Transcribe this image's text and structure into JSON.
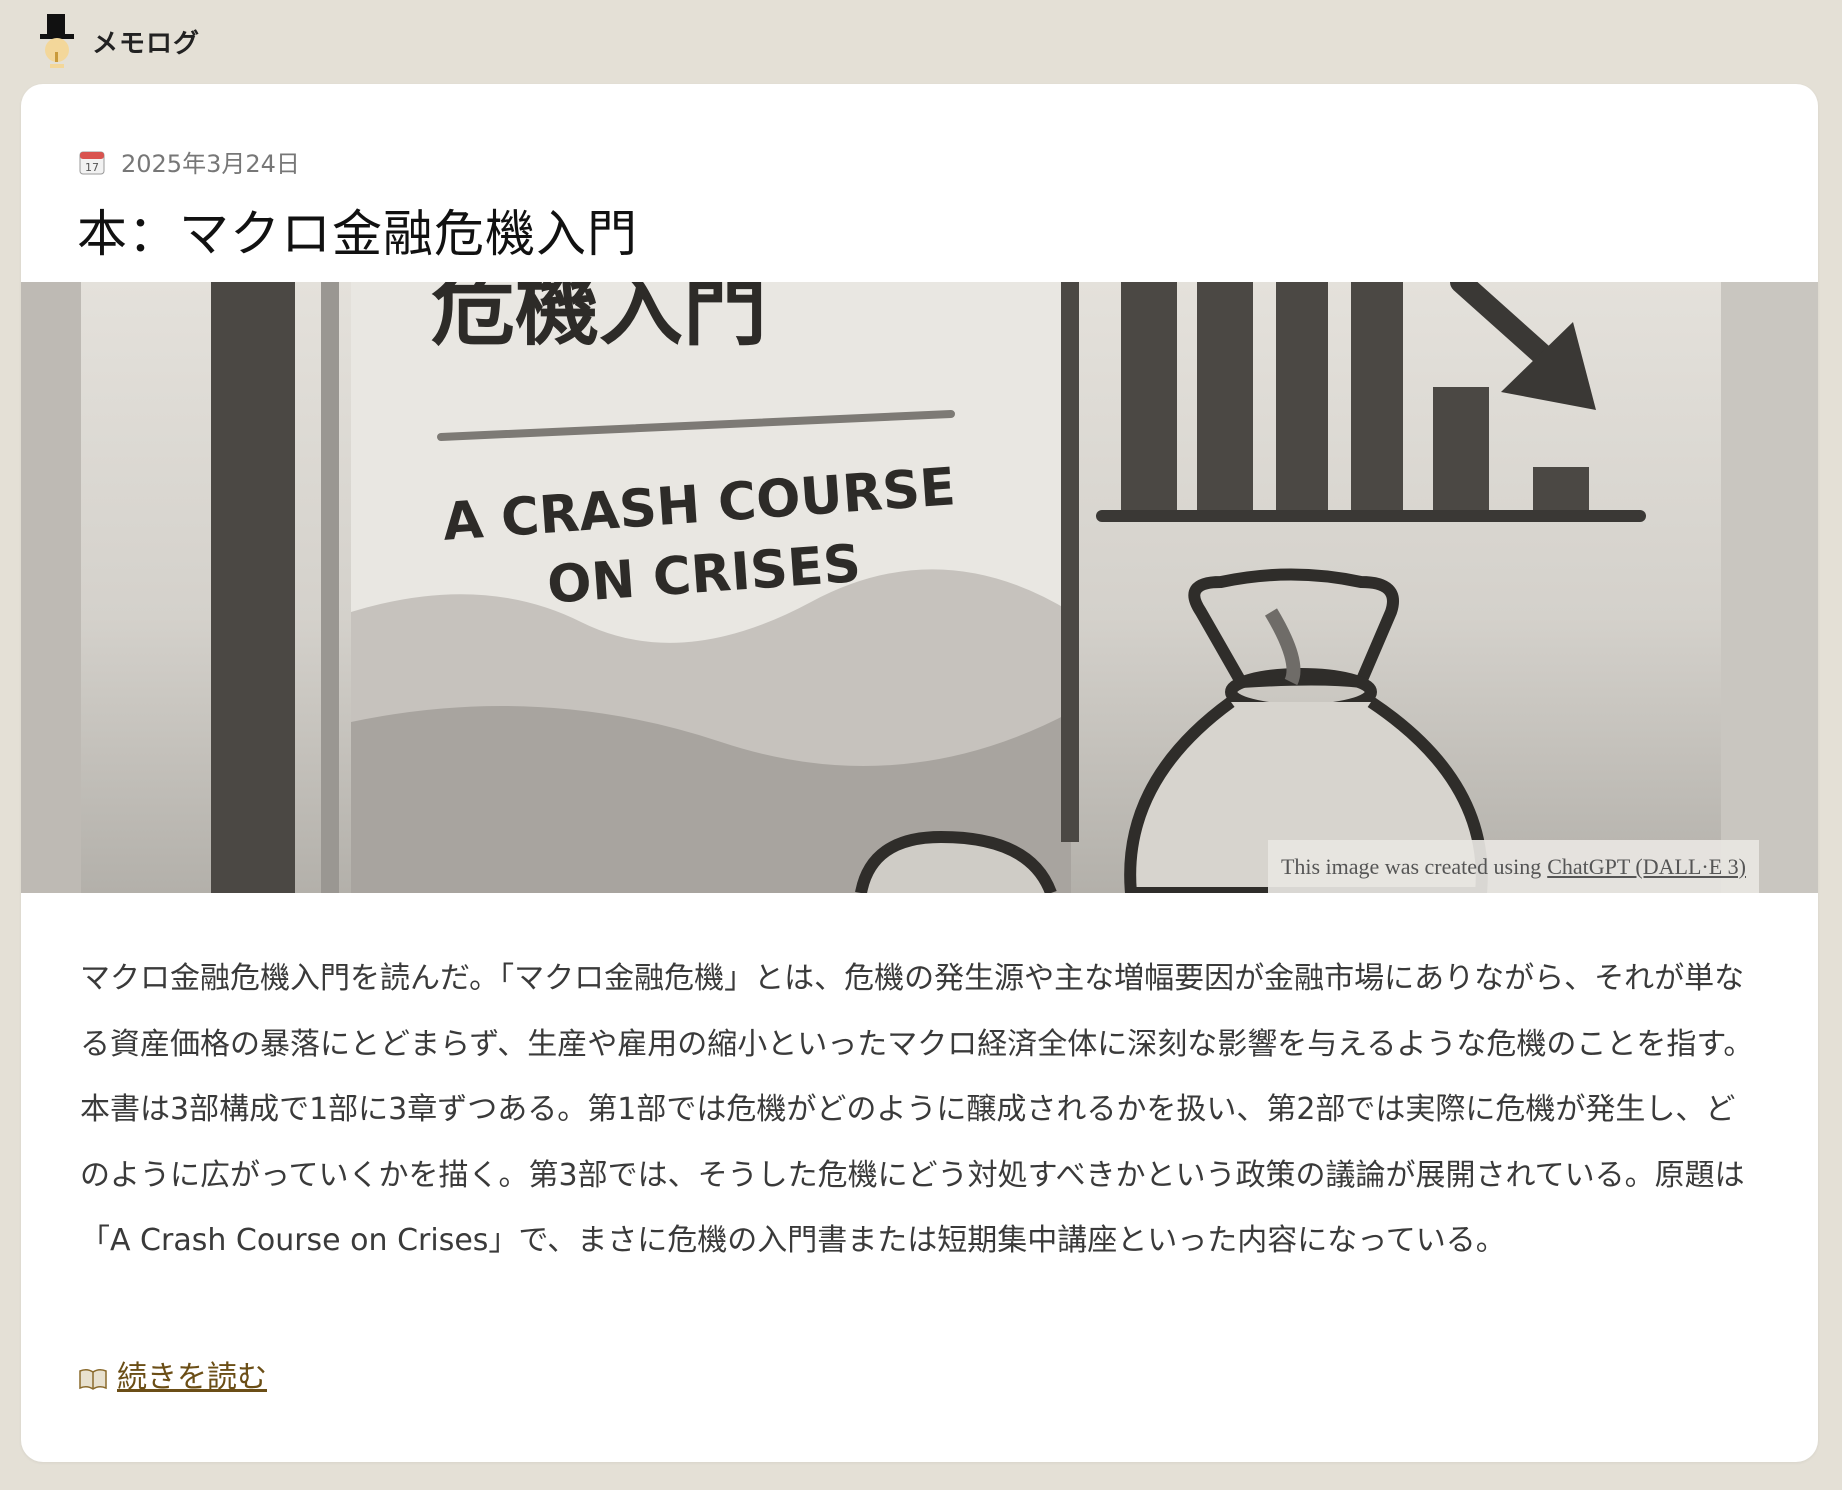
{
  "site": {
    "title": "メモログ"
  },
  "post": {
    "date": "2025年3月24日",
    "title": "本：マクロ金融危機入門",
    "image": {
      "cover_title": "危機入門",
      "cover_subtitle_line1": "A CRASH COURSE",
      "cover_subtitle_line2": "ON CRISES",
      "credit_prefix": "This image was created using",
      "credit_link": "ChatGPT (DALL·E 3)"
    },
    "excerpt": "マクロ金融危機入門を読んだ。「マクロ金融危機」とは、危機の発生源や主な増幅要因が金融市場にありながら、それが単なる資産価格の暴落にとどまらず、生産や雇用の縮小といったマクロ経済全体に深刻な影響を与えるような危機のことを指す。本書は3部構成で1部に3章ずつある。第1部では危機がどのように醸成されるかを扱い、第2部では実際に危機が発生し、どのように広がっていくかを描く。第3部では、そうした危機にどう対処すべきかという政策の議論が展開されている。原題は「A Crash Course on Crises」で、まさに危機の入門書または短期集中講座といった内容になっている。",
    "read_more": "続きを読む"
  },
  "icons": {
    "logo": "top-hat-character-icon",
    "date": "calendar-icon",
    "read_more": "open-book-icon"
  },
  "colors": {
    "page_background": "#e4e0d6",
    "card_background": "#ffffff",
    "link": "#6b4e16"
  }
}
